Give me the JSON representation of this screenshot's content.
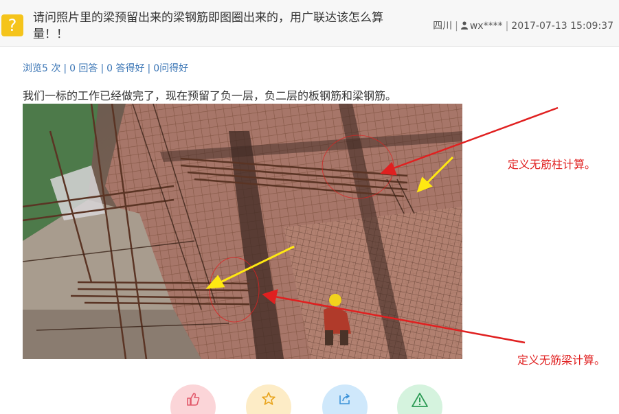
{
  "question": {
    "icon": "question-mark-icon",
    "icon_glyph": "?",
    "title": "请问照片里的梁预留出来的梁钢筋即图圈出来的，用广联达该怎么算量！！",
    "location": "四川",
    "user": "wx****",
    "date": "2017-07-13 15:09:37"
  },
  "stats": {
    "views": "浏览5 次",
    "answers": "0 回答",
    "good_answers": "0 答得好",
    "asked_good": "0问得好"
  },
  "body": {
    "text": "我们一标的工作已经做完了，现在预留了负一层，负二层的板钢筋和梁钢筋。"
  },
  "annotations": {
    "column": "定义无筋柱计算。",
    "beam": "定义无筋梁计算。"
  },
  "actions": [
    {
      "name": "like-icon",
      "color": "#fbd5d8"
    },
    {
      "name": "star-icon",
      "color": "#fdecc6"
    },
    {
      "name": "share-icon",
      "color": "#cfe8fb"
    },
    {
      "name": "warning-icon",
      "color": "#d5f3de"
    }
  ],
  "colors": {
    "link": "#3a75b5",
    "annotation": "#e02020",
    "icon_bg": "#f5c41b"
  }
}
